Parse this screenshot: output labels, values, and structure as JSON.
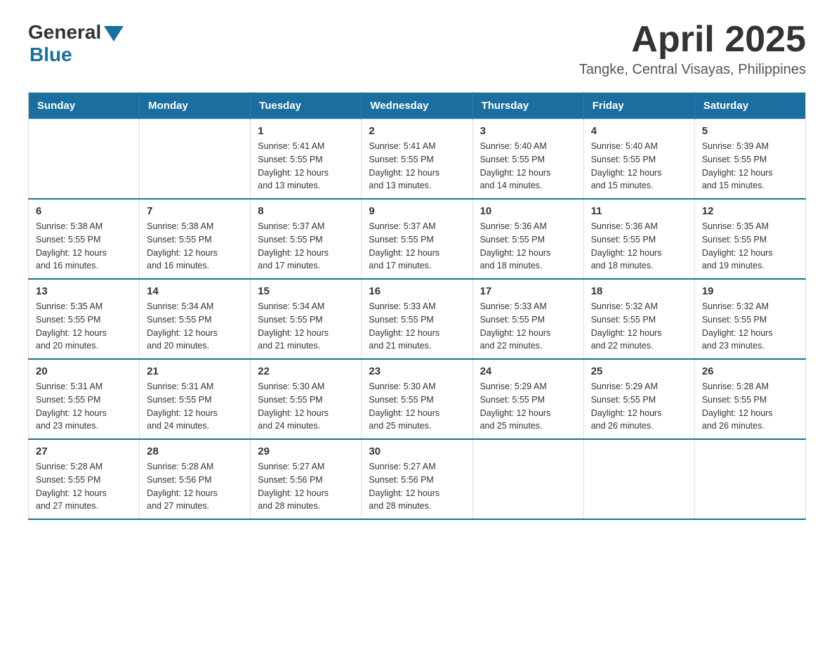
{
  "header": {
    "logo_general": "General",
    "logo_blue": "Blue",
    "month_title": "April 2025",
    "location": "Tangke, Central Visayas, Philippines"
  },
  "calendar": {
    "days_of_week": [
      "Sunday",
      "Monday",
      "Tuesday",
      "Wednesday",
      "Thursday",
      "Friday",
      "Saturday"
    ],
    "weeks": [
      [
        {
          "day": "",
          "info": ""
        },
        {
          "day": "",
          "info": ""
        },
        {
          "day": "1",
          "info": "Sunrise: 5:41 AM\nSunset: 5:55 PM\nDaylight: 12 hours\nand 13 minutes."
        },
        {
          "day": "2",
          "info": "Sunrise: 5:41 AM\nSunset: 5:55 PM\nDaylight: 12 hours\nand 13 minutes."
        },
        {
          "day": "3",
          "info": "Sunrise: 5:40 AM\nSunset: 5:55 PM\nDaylight: 12 hours\nand 14 minutes."
        },
        {
          "day": "4",
          "info": "Sunrise: 5:40 AM\nSunset: 5:55 PM\nDaylight: 12 hours\nand 15 minutes."
        },
        {
          "day": "5",
          "info": "Sunrise: 5:39 AM\nSunset: 5:55 PM\nDaylight: 12 hours\nand 15 minutes."
        }
      ],
      [
        {
          "day": "6",
          "info": "Sunrise: 5:38 AM\nSunset: 5:55 PM\nDaylight: 12 hours\nand 16 minutes."
        },
        {
          "day": "7",
          "info": "Sunrise: 5:38 AM\nSunset: 5:55 PM\nDaylight: 12 hours\nand 16 minutes."
        },
        {
          "day": "8",
          "info": "Sunrise: 5:37 AM\nSunset: 5:55 PM\nDaylight: 12 hours\nand 17 minutes."
        },
        {
          "day": "9",
          "info": "Sunrise: 5:37 AM\nSunset: 5:55 PM\nDaylight: 12 hours\nand 17 minutes."
        },
        {
          "day": "10",
          "info": "Sunrise: 5:36 AM\nSunset: 5:55 PM\nDaylight: 12 hours\nand 18 minutes."
        },
        {
          "day": "11",
          "info": "Sunrise: 5:36 AM\nSunset: 5:55 PM\nDaylight: 12 hours\nand 18 minutes."
        },
        {
          "day": "12",
          "info": "Sunrise: 5:35 AM\nSunset: 5:55 PM\nDaylight: 12 hours\nand 19 minutes."
        }
      ],
      [
        {
          "day": "13",
          "info": "Sunrise: 5:35 AM\nSunset: 5:55 PM\nDaylight: 12 hours\nand 20 minutes."
        },
        {
          "day": "14",
          "info": "Sunrise: 5:34 AM\nSunset: 5:55 PM\nDaylight: 12 hours\nand 20 minutes."
        },
        {
          "day": "15",
          "info": "Sunrise: 5:34 AM\nSunset: 5:55 PM\nDaylight: 12 hours\nand 21 minutes."
        },
        {
          "day": "16",
          "info": "Sunrise: 5:33 AM\nSunset: 5:55 PM\nDaylight: 12 hours\nand 21 minutes."
        },
        {
          "day": "17",
          "info": "Sunrise: 5:33 AM\nSunset: 5:55 PM\nDaylight: 12 hours\nand 22 minutes."
        },
        {
          "day": "18",
          "info": "Sunrise: 5:32 AM\nSunset: 5:55 PM\nDaylight: 12 hours\nand 22 minutes."
        },
        {
          "day": "19",
          "info": "Sunrise: 5:32 AM\nSunset: 5:55 PM\nDaylight: 12 hours\nand 23 minutes."
        }
      ],
      [
        {
          "day": "20",
          "info": "Sunrise: 5:31 AM\nSunset: 5:55 PM\nDaylight: 12 hours\nand 23 minutes."
        },
        {
          "day": "21",
          "info": "Sunrise: 5:31 AM\nSunset: 5:55 PM\nDaylight: 12 hours\nand 24 minutes."
        },
        {
          "day": "22",
          "info": "Sunrise: 5:30 AM\nSunset: 5:55 PM\nDaylight: 12 hours\nand 24 minutes."
        },
        {
          "day": "23",
          "info": "Sunrise: 5:30 AM\nSunset: 5:55 PM\nDaylight: 12 hours\nand 25 minutes."
        },
        {
          "day": "24",
          "info": "Sunrise: 5:29 AM\nSunset: 5:55 PM\nDaylight: 12 hours\nand 25 minutes."
        },
        {
          "day": "25",
          "info": "Sunrise: 5:29 AM\nSunset: 5:55 PM\nDaylight: 12 hours\nand 26 minutes."
        },
        {
          "day": "26",
          "info": "Sunrise: 5:28 AM\nSunset: 5:55 PM\nDaylight: 12 hours\nand 26 minutes."
        }
      ],
      [
        {
          "day": "27",
          "info": "Sunrise: 5:28 AM\nSunset: 5:55 PM\nDaylight: 12 hours\nand 27 minutes."
        },
        {
          "day": "28",
          "info": "Sunrise: 5:28 AM\nSunset: 5:56 PM\nDaylight: 12 hours\nand 27 minutes."
        },
        {
          "day": "29",
          "info": "Sunrise: 5:27 AM\nSunset: 5:56 PM\nDaylight: 12 hours\nand 28 minutes."
        },
        {
          "day": "30",
          "info": "Sunrise: 5:27 AM\nSunset: 5:56 PM\nDaylight: 12 hours\nand 28 minutes."
        },
        {
          "day": "",
          "info": ""
        },
        {
          "day": "",
          "info": ""
        },
        {
          "day": "",
          "info": ""
        }
      ]
    ]
  }
}
